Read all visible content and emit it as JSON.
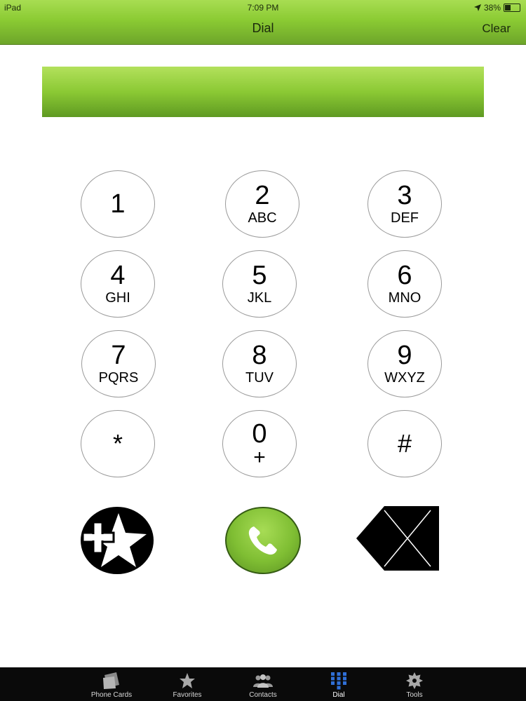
{
  "status_bar": {
    "device": "iPad",
    "time": "7:09 PM",
    "battery": "38%",
    "battery_level": 0.38,
    "location_icon": "location-arrow-icon"
  },
  "nav": {
    "title": "Dial",
    "clear_label": "Clear"
  },
  "display": {
    "number": ""
  },
  "keypad": {
    "keys": [
      {
        "digit": "1",
        "letters": ""
      },
      {
        "digit": "2",
        "letters": "ABC"
      },
      {
        "digit": "3",
        "letters": "DEF"
      },
      {
        "digit": "4",
        "letters": "GHI"
      },
      {
        "digit": "5",
        "letters": "JKL"
      },
      {
        "digit": "6",
        "letters": "MNO"
      },
      {
        "digit": "7",
        "letters": "PQRS"
      },
      {
        "digit": "8",
        "letters": "TUV"
      },
      {
        "digit": "9",
        "letters": "WXYZ"
      },
      {
        "digit": "*",
        "letters": ""
      },
      {
        "digit": "0",
        "letters": "+"
      },
      {
        "digit": "#",
        "letters": ""
      }
    ]
  },
  "actions": {
    "add_favorite_icon": "star-plus-icon",
    "call_icon": "phone-handset-icon",
    "backspace_icon": "backspace-x-icon"
  },
  "tabs": [
    {
      "label": "Phone Cards",
      "icon": "phone-cards-icon",
      "active": false
    },
    {
      "label": "Favorites",
      "icon": "star-icon",
      "active": false
    },
    {
      "label": "Contacts",
      "icon": "people-icon",
      "active": false
    },
    {
      "label": "Dial",
      "icon": "keypad-grid-icon",
      "active": true
    },
    {
      "label": "Tools",
      "icon": "gear-icon",
      "active": false
    }
  ],
  "colors": {
    "brand_green": "#8bcb33",
    "active_tab_icon": "#2f6fd6",
    "tab_bar": "#0a0a0a"
  }
}
